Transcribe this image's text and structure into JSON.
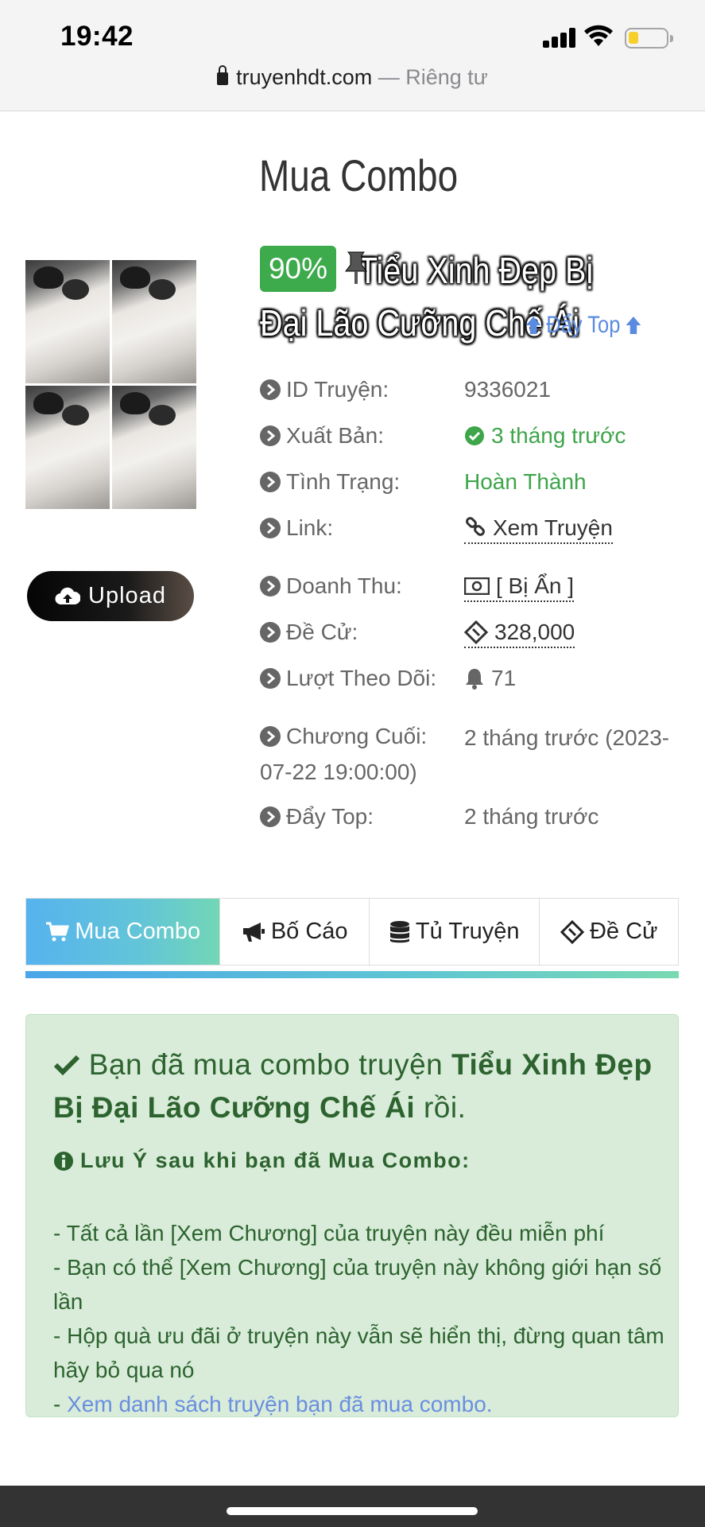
{
  "status_bar": {
    "time": "19:42"
  },
  "address_bar": {
    "domain": "truyenhdt.com",
    "separator": " — ",
    "privacy": "Riêng tư"
  },
  "header": {
    "title": "Mua Combo"
  },
  "story": {
    "percent": "90%",
    "title": "Tiểu Xinh Đẹp Bị Đại Lão Cưỡng Chế Ái",
    "top_link": "Đẩy Top"
  },
  "upload": {
    "label": "Upload"
  },
  "info": {
    "id_label": "ID Truyện:",
    "id_value": "9336021",
    "publish_label": "Xuất Bản:",
    "publish_value": "3 tháng trước",
    "status_label": "Tình Trạng:",
    "status_value": "Hoàn Thành",
    "link_label": "Link:",
    "link_value": "Xem Truyện",
    "revenue_label": "Doanh Thu:",
    "revenue_value": "[ Bị Ẩn ]",
    "nominate_label": "Đề Cử:",
    "nominate_value": "328,000",
    "follow_label": "Lượt Theo Dõi:",
    "follow_value": "71",
    "last_chapter_label": "Chương Cuối:",
    "last_chapter_value": "2 tháng trước (2023-07-22 19:00:00)",
    "push_top_label": "Đẩy Top:",
    "push_top_value": "2 tháng trước"
  },
  "tabs": [
    {
      "label": "Mua Combo",
      "icon": "cart-icon"
    },
    {
      "label": "Bố Cáo",
      "icon": "bullhorn-icon"
    },
    {
      "label": "Tủ Truyện",
      "icon": "database-icon"
    },
    {
      "label": "Đề Cử",
      "icon": "ticket-icon"
    }
  ],
  "success": {
    "prefix": "Bạn đã mua combo truyện",
    "story": "Tiểu Xinh Đẹp Bị Đại Lão Cưỡng Chế Ái",
    "suffix": "rồi.",
    "note_title": "Lưu Ý sau khi bạn đã Mua Combo:",
    "line1": "- Tất cả lần [Xem Chương] của truyện này đều miễn phí",
    "line2": "- Bạn có thể [Xem Chương] của truyện này không giới hạn số lần",
    "line3": "- Hộp quà ưu đãi ở truyện này vẫn sẽ hiển thị, đừng quan tâm hãy bỏ qua nó",
    "line4_prefix": "- ",
    "line4_link": "Xem danh sách truyện bạn đã mua combo."
  }
}
